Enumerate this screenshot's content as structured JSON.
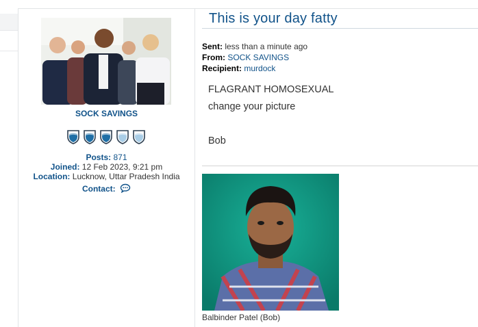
{
  "profile": {
    "username": "SOCK SAVINGS",
    "rank_icon": "shield-rank-icon",
    "rank_filled": 3,
    "rank_total": 5,
    "posts_label": "Posts:",
    "posts_value": "871",
    "joined_label": "Joined:",
    "joined_value": "12 Feb 2023, 9:21 pm",
    "location_label": "Location:",
    "location_value": "Lucknow, Uttar Pradesh India",
    "contact_label": "Contact:",
    "contact_icon": "speech-bubble-icon"
  },
  "message": {
    "title": "This is your day fatty",
    "sent_label": "Sent:",
    "sent_value": "less than a minute ago",
    "from_label": "From:",
    "from_value": "SOCK SAVINGS",
    "recipient_label": "Recipient:",
    "recipient_value": "murdock",
    "body_line1": "FLAGRANT HOMOSEXUAL",
    "body_line2": "change your picture",
    "body_line3": "Bob"
  },
  "signature": {
    "caption": "Balbinder Patel (Bob)"
  },
  "colors": {
    "link": "#105289",
    "rank_shield": "#1f6fa6",
    "rank_shield_empty": "#a9cde6",
    "photo_bg": "#0f9c86"
  }
}
